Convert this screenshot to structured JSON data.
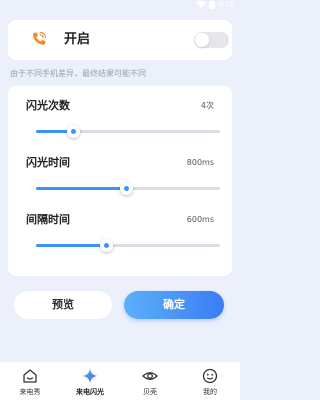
{
  "status_bar": {
    "time": "2:16"
  },
  "flash_switch": {
    "label": "开启",
    "icon": "phone-icon",
    "enabled": false,
    "accent_color": "#f08a2b"
  },
  "hint": "由于不同手机差异，最终结果可能不同",
  "settings": [
    {
      "key": "flash_count",
      "label": "闪光次数",
      "value_text": "4次",
      "level": 0.2
    },
    {
      "key": "flash_time",
      "label": "闪光时间",
      "value_text": "800ms",
      "level": 0.49
    },
    {
      "key": "interval_time",
      "label": "间隔时间",
      "value_text": "600ms",
      "level": 0.38
    }
  ],
  "buttons": {
    "preview": "预览",
    "confirm": "确定"
  },
  "nav": [
    {
      "label": "来电秀",
      "icon": "home-icon",
      "active": false
    },
    {
      "label": "来电闪光",
      "icon": "sparkle-icon",
      "active": true
    },
    {
      "label": "贝壳",
      "icon": "eye-icon",
      "active": false
    },
    {
      "label": "我的",
      "icon": "smiley-icon",
      "active": false
    }
  ],
  "colors": {
    "accent": "#3d94f7",
    "background": "#ecf0fb",
    "icon_orange": "#f08a2b"
  }
}
